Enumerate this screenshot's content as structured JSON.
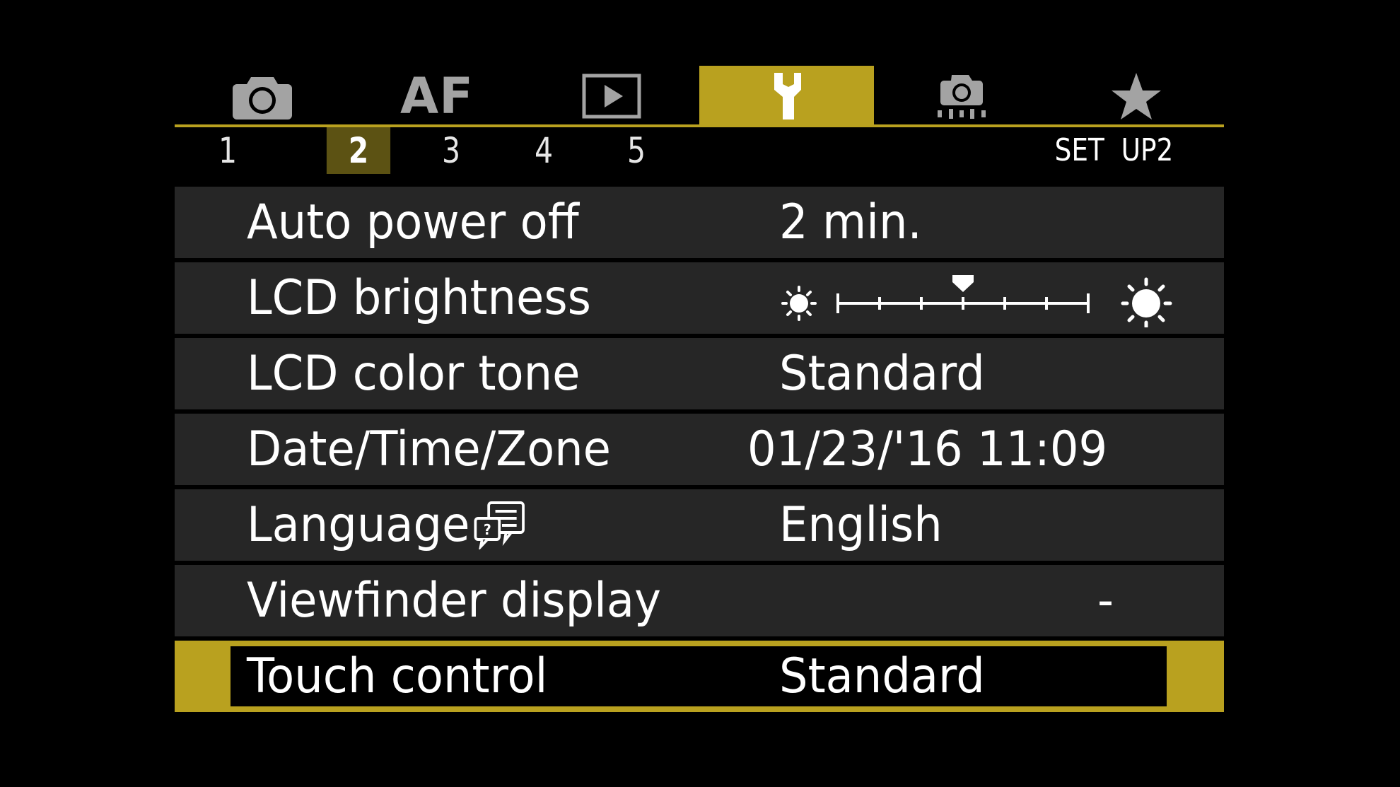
{
  "tabs": [
    {
      "icon": "camera-icon",
      "label": ""
    },
    {
      "icon": "af-icon",
      "label": "AF"
    },
    {
      "icon": "playback-icon",
      "label": ""
    },
    {
      "icon": "wrench-icon",
      "label": ""
    },
    {
      "icon": "custom-functions-icon",
      "label": ""
    },
    {
      "icon": "star-icon",
      "label": ""
    }
  ],
  "active_tab": 3,
  "subtabs": [
    "1",
    "2",
    "3",
    "4",
    "5"
  ],
  "active_subtab": 1,
  "page_label": "SET  UP2",
  "menu": [
    {
      "label": "Auto power off",
      "value": "2 min."
    },
    {
      "label": "LCD brightness",
      "value": "",
      "brightness_level": 3,
      "brightness_steps": 7
    },
    {
      "label": "LCD color tone",
      "value": "Standard"
    },
    {
      "label": "Date/Time/Zone",
      "value": "01/23/'16 11:09"
    },
    {
      "label": "Language",
      "value": "English"
    },
    {
      "label": "Viewfinder display",
      "value": "-"
    },
    {
      "label": "Touch control",
      "value": "Standard"
    }
  ],
  "selected_index": 6,
  "colors": {
    "accent": "#b9a11f",
    "subtab_active": "#5c5213",
    "row_bg": "#262626",
    "inactive_icon": "#a3a3a3"
  }
}
